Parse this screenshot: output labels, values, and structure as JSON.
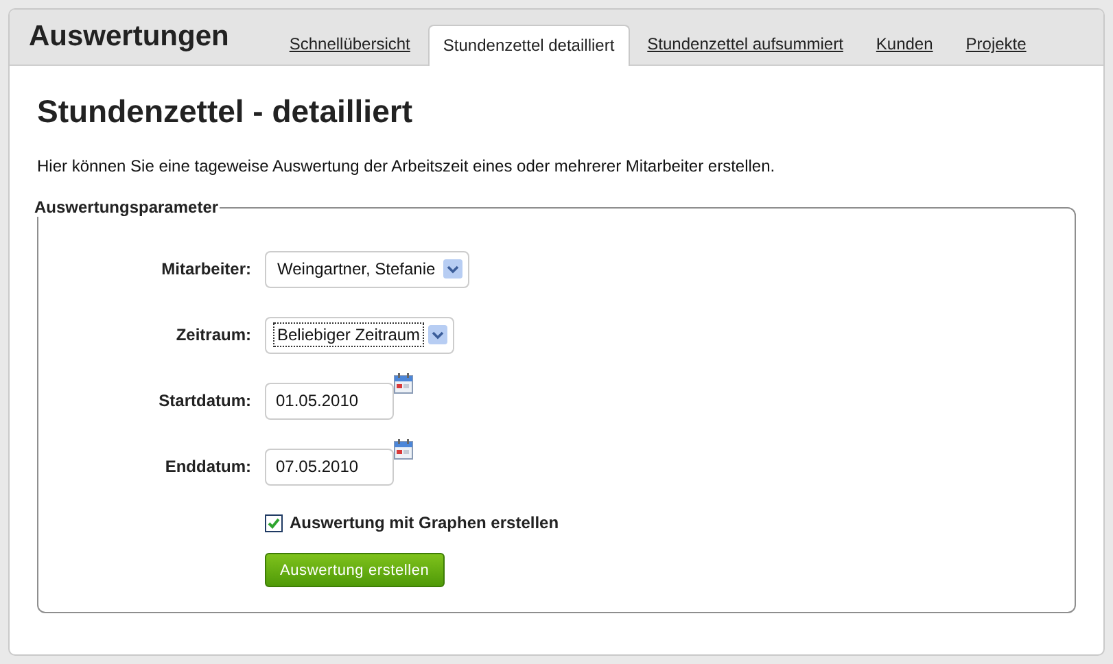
{
  "header": {
    "title": "Auswertungen"
  },
  "tabs": [
    {
      "label": "Schnellübersicht",
      "selected": false
    },
    {
      "label": "Stundenzettel detailliert",
      "selected": true
    },
    {
      "label": "Stundenzettel aufsummiert",
      "selected": false
    },
    {
      "label": "Kunden",
      "selected": false
    },
    {
      "label": "Projekte",
      "selected": false
    }
  ],
  "page": {
    "heading": "Stundenzettel - detailliert",
    "description": "Hier können Sie eine tageweise Auswertung der Arbeitszeit eines oder mehrerer Mitarbeiter erstellen."
  },
  "form": {
    "legend": "Auswertungsparameter",
    "fields": [
      {
        "kind": "select",
        "label": "Mitarbeiter:",
        "value": "Weingartner, Stefanie",
        "focused": false
      },
      {
        "kind": "select",
        "label": "Zeitraum:",
        "value": "Beliebiger Zeitraum",
        "focused": true
      },
      {
        "kind": "date",
        "label": "Startdatum:",
        "value": "01.05.2010"
      },
      {
        "kind": "date",
        "label": "Enddatum:",
        "value": "07.05.2010"
      }
    ],
    "checkbox": {
      "label": "Auswertung mit Graphen erstellen",
      "checked": true
    },
    "submit": "Auswertung erstellen"
  }
}
